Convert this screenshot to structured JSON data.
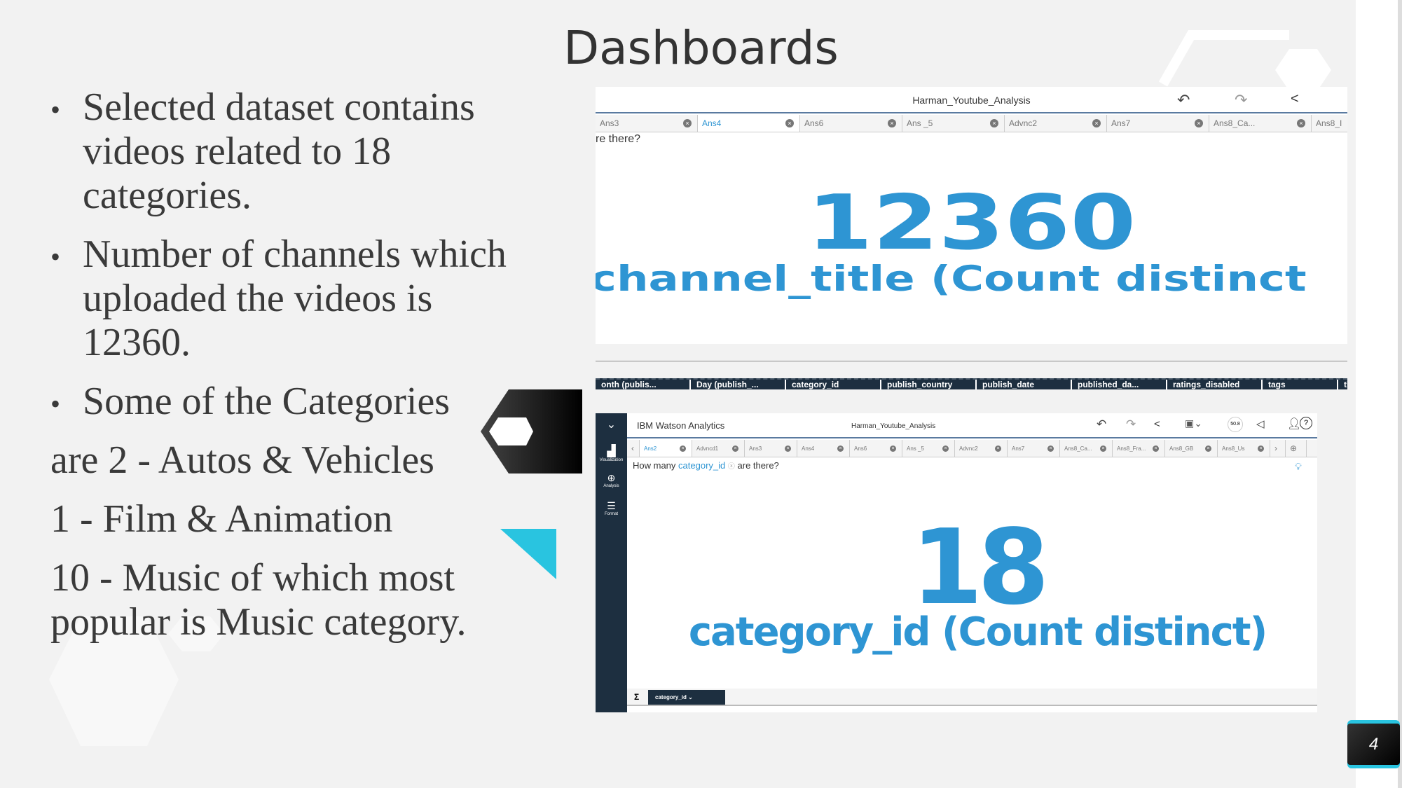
{
  "slide": {
    "title": "Dashboards",
    "page_number": "4"
  },
  "bullets": [
    "Selected dataset contains videos  related to 18 categories.",
    "Number of channels  which uploaded  the videos  is 12360.",
    "Some of the Categories"
  ],
  "lines": [
    "are 2 - Autos & Vehicles",
    "1 - Film & Animation",
    "10 - Music  of which most popular is Music category."
  ],
  "top_panel": {
    "title": "Harman_Youtube_Analysis",
    "tabs": [
      "Ans3",
      "Ans4",
      "Ans6",
      "Ans _5",
      "Advnc2",
      "Ans7",
      "Ans8_Ca...",
      "Ans8_I"
    ],
    "active_tab": "Ans4",
    "question": "re there?",
    "value": "12360",
    "label": "channel_title (Count distinct"
  },
  "field_strip": [
    "onth (publis...",
    "Day (publish_...",
    "category_id",
    "publish_country",
    "publish_date",
    "published_da...",
    "ratings_disabled",
    "tags",
    "ti"
  ],
  "bottom_panel": {
    "app_name": "IBM Watson Analytics",
    "title": "Harman_Youtube_Analysis",
    "tabs": [
      "Ans2",
      "Advncd1",
      "Ans3",
      "Ans4",
      "Ans6",
      "Ans _5",
      "Advnc2",
      "Ans7",
      "Ans8_Ca...",
      "Ans8_Fra...",
      "Ans8_GB",
      "Ans8_Us"
    ],
    "active_tab": "Ans2",
    "sidebar": [
      "Visualization",
      "Analysis",
      "Format"
    ],
    "question_prefix": "How many",
    "question_field": "category_id",
    "question_suffix": "are there?",
    "value": "18",
    "label": "category_id (Count distinct)",
    "meter": "50.8",
    "footer_sigma": "Σ",
    "footer_field": "category_id"
  },
  "colors": {
    "accent": "#2e95d3",
    "dark": "#1d2f40",
    "cyan": "#29c4e0"
  }
}
